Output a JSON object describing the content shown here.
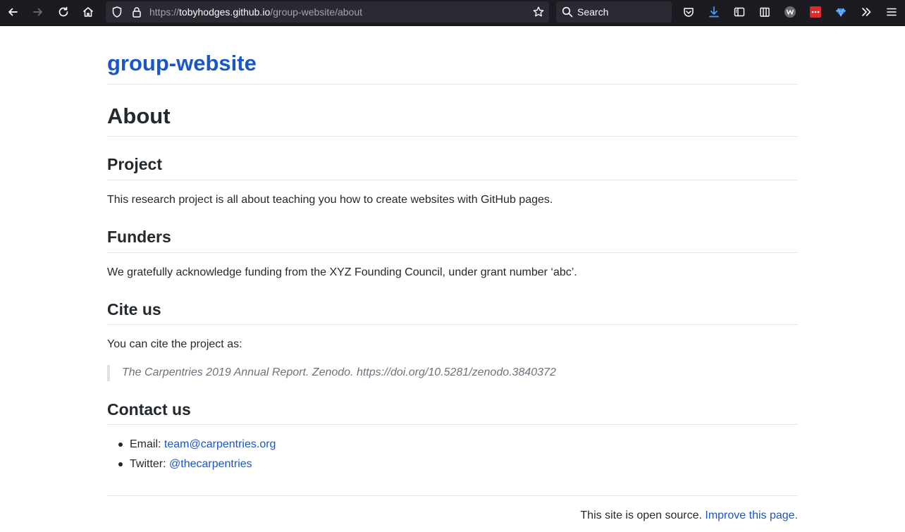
{
  "browser": {
    "url_scheme": "https://",
    "url_host": "tobyhodges.github.io",
    "url_path": "/group-website/about",
    "search_placeholder": "Search"
  },
  "site": {
    "title": "group-website"
  },
  "page": {
    "heading": "About",
    "sections": {
      "project": {
        "heading": "Project",
        "text": "This research project is all about teaching you how to create websites with GitHub pages."
      },
      "funders": {
        "heading": "Funders",
        "text": "We gratefully acknowledge funding from the XYZ Founding Council, under grant number ‘abc’."
      },
      "cite": {
        "heading": "Cite us",
        "text": "You can cite the project as:",
        "quote": "The Carpentries 2019 Annual Report. Zenodo. https://doi.org/10.5281/zenodo.3840372"
      },
      "contact": {
        "heading": "Contact us",
        "email_label": "Email:",
        "email_value": "team@carpentries.org",
        "twitter_label": "Twitter:",
        "twitter_value": "@thecarpentries"
      }
    }
  },
  "footer": {
    "text": "This site is open source.",
    "link": "Improve this page."
  },
  "colors": {
    "link": "#1a56c8",
    "text": "#24292e",
    "chrome_bg": "#1c1b22"
  }
}
